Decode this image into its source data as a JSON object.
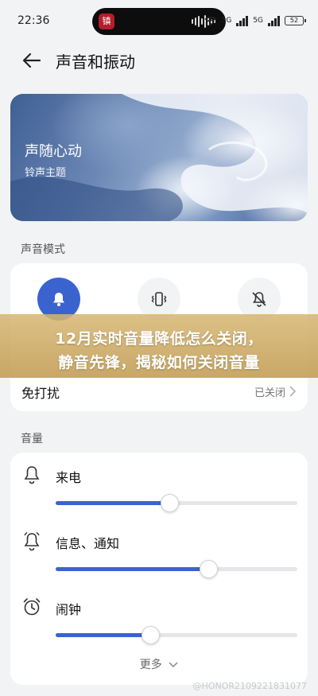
{
  "status_bar": {
    "time": "22:36",
    "island_app_label": "镇",
    "network_1": "5G",
    "network_2": "5G",
    "battery": "52"
  },
  "header": {
    "title": "声音和振动",
    "back_icon": "arrow-left-icon"
  },
  "banner": {
    "title": "声随心动",
    "subtitle": "铃声主题"
  },
  "sound_mode": {
    "section_label": "声音模式",
    "modes": [
      {
        "icon": "bell-icon",
        "active": true
      },
      {
        "icon": "vibrate-icon",
        "active": false
      },
      {
        "icon": "bell-off-icon",
        "active": false
      }
    ],
    "dnd_label": "免打扰",
    "dnd_value": "已关闭"
  },
  "overlay": {
    "line1": "12月实时音量降低怎么关闭，",
    "line2": "静音先锋，揭秘如何关闭音量"
  },
  "volume": {
    "section_label": "音量",
    "items": [
      {
        "label": "来电",
        "icon": "bell-outline-icon",
        "level": 0.47
      },
      {
        "label": "信息、通知",
        "icon": "notification-bell-icon",
        "level": 0.63
      },
      {
        "label": "闹钟",
        "icon": "alarm-clock-icon",
        "level": 0.39
      }
    ],
    "more_label": "更多"
  },
  "watermark": "@HONOR2109221831077",
  "colors": {
    "accent": "#3b63d0",
    "background": "#f1f3f5",
    "overlay": "#c9a561"
  }
}
